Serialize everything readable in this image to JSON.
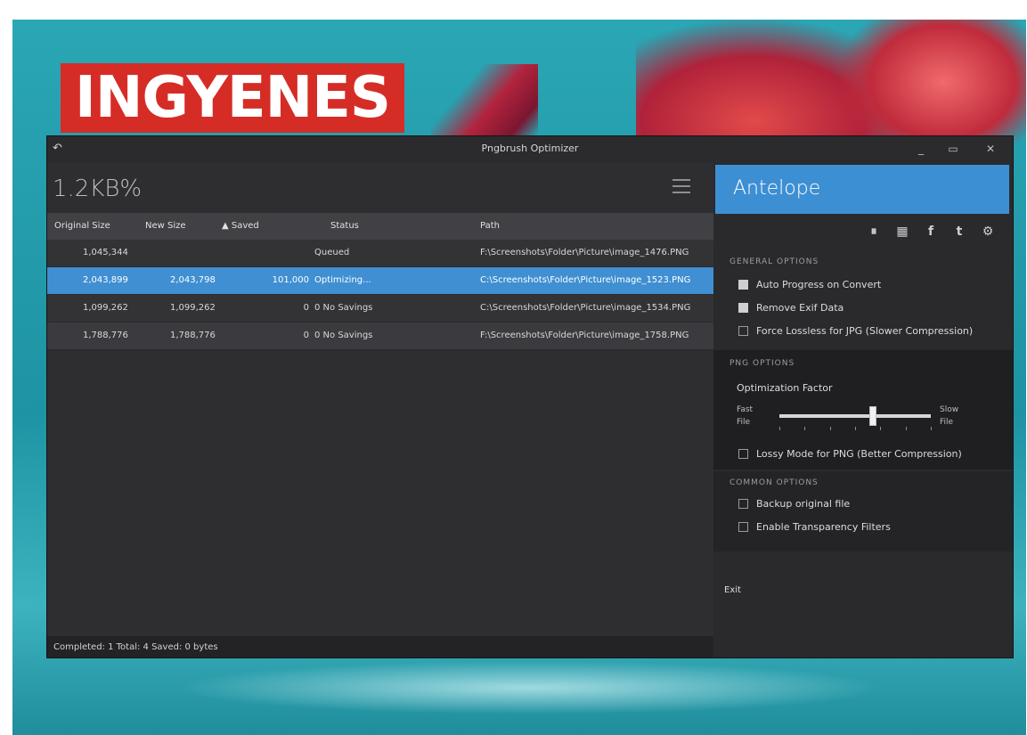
{
  "banner": {
    "text": "INGYENES"
  },
  "window": {
    "title": "Pngbrush Optimizer",
    "app_icon": "back-arrow-icon",
    "controls": {
      "minimize": "_",
      "maximize": "▭",
      "close": "✕"
    }
  },
  "summary": {
    "savings": "1.2KB%"
  },
  "table": {
    "columns": [
      "Original Size",
      "New Size",
      "▲ Saved",
      "Status",
      "Path"
    ],
    "rows": [
      {
        "original": "1,045,344",
        "new": "",
        "saved": "",
        "status": "Queued",
        "path": "F:\\Screenshots\\Folder\\Picture\\image_1476.PNG",
        "selected": false
      },
      {
        "original": "2,043,899",
        "new": "2,043,798",
        "saved": "101,000",
        "status": "Optimizing...",
        "path": "C:\\Screenshots\\Folder\\Picture\\image_1523.PNG",
        "selected": true
      },
      {
        "original": "1,099,262",
        "new": "1,099,262",
        "saved": "0",
        "status": "0 No Savings",
        "path": "C:\\Screenshots\\Folder\\Picture\\image_1534.PNG",
        "selected": false
      },
      {
        "original": "1,788,776",
        "new": "1,788,776",
        "saved": "0",
        "status": "0 No Savings",
        "path": "F:\\Screenshots\\Folder\\Picture\\image_1758.PNG",
        "selected": false
      }
    ]
  },
  "status_bar": {
    "text": "Completed: 1 Total: 4 Saved: 0 bytes"
  },
  "side_panel": {
    "ad_text": "Antelope",
    "share_icons": [
      "pause-icon",
      "save-icon",
      "facebook-icon",
      "twitter-icon",
      "settings-icon"
    ],
    "share_glyphs": [
      "⏸",
      "▦",
      "f",
      "t",
      "⚙"
    ],
    "general": {
      "title": "GENERAL OPTIONS",
      "options": [
        {
          "label": "Auto Progress on Convert",
          "checked": true
        },
        {
          "label": "Remove Exif Data",
          "checked": true
        },
        {
          "label": "Force Lossless for JPG (Slower Compression)",
          "checked": false
        }
      ]
    },
    "png": {
      "title": "PNG OPTIONS",
      "slider_label": "Optimization Factor",
      "slider_left": "Fast\nFile",
      "slider_right": "Slow\nFile",
      "slider_value_percent": 62,
      "options": [
        {
          "label": "Lossy Mode for PNG (Better Compression)",
          "checked": false
        }
      ]
    },
    "other": {
      "title": "COMMON OPTIONS",
      "options": [
        {
          "label": "Backup original file",
          "checked": false
        },
        {
          "label": "Enable Transparency Filters",
          "checked": false
        }
      ]
    },
    "exit": "Exit"
  }
}
